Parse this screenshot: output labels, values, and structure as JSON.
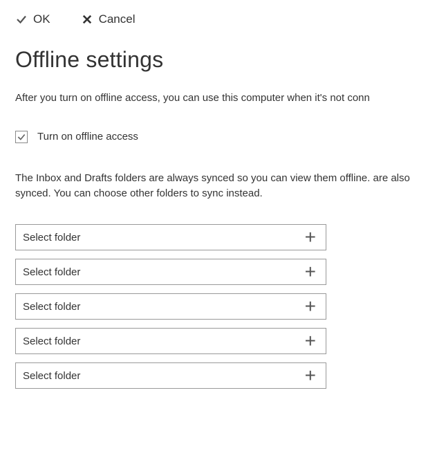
{
  "toolbar": {
    "ok_label": "OK",
    "cancel_label": "Cancel"
  },
  "page": {
    "title": "Offline settings",
    "intro": "After you turn on offline access, you can use this computer when it's not conn",
    "sync_text": "The Inbox and Drafts folders are always synced so you can view them offline. are also synced. You can choose other folders to sync instead."
  },
  "checkbox": {
    "label": "Turn on offline access",
    "checked": true
  },
  "folder_selectors": [
    {
      "label": "Select folder"
    },
    {
      "label": "Select folder"
    },
    {
      "label": "Select folder"
    },
    {
      "label": "Select folder"
    },
    {
      "label": "Select folder"
    }
  ]
}
